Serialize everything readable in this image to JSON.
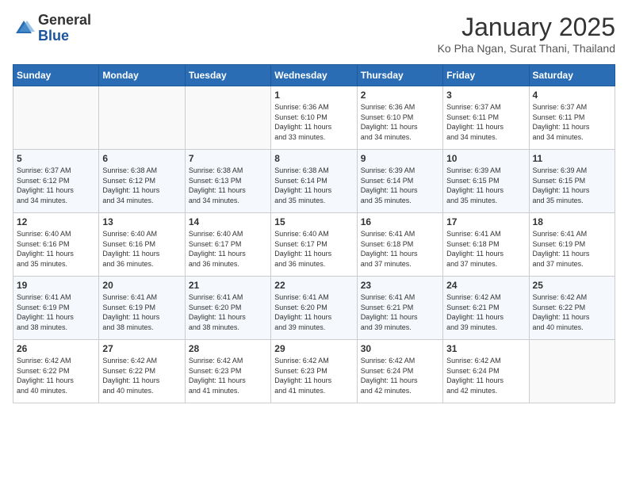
{
  "header": {
    "logo": {
      "general": "General",
      "blue": "Blue"
    },
    "title": "January 2025",
    "subtitle": "Ko Pha Ngan, Surat Thani, Thailand"
  },
  "days_of_week": [
    "Sunday",
    "Monday",
    "Tuesday",
    "Wednesday",
    "Thursday",
    "Friday",
    "Saturday"
  ],
  "weeks": [
    [
      {
        "num": "",
        "info": ""
      },
      {
        "num": "",
        "info": ""
      },
      {
        "num": "",
        "info": ""
      },
      {
        "num": "1",
        "info": "Sunrise: 6:36 AM\nSunset: 6:10 PM\nDaylight: 11 hours\nand 33 minutes."
      },
      {
        "num": "2",
        "info": "Sunrise: 6:36 AM\nSunset: 6:10 PM\nDaylight: 11 hours\nand 34 minutes."
      },
      {
        "num": "3",
        "info": "Sunrise: 6:37 AM\nSunset: 6:11 PM\nDaylight: 11 hours\nand 34 minutes."
      },
      {
        "num": "4",
        "info": "Sunrise: 6:37 AM\nSunset: 6:11 PM\nDaylight: 11 hours\nand 34 minutes."
      }
    ],
    [
      {
        "num": "5",
        "info": "Sunrise: 6:37 AM\nSunset: 6:12 PM\nDaylight: 11 hours\nand 34 minutes."
      },
      {
        "num": "6",
        "info": "Sunrise: 6:38 AM\nSunset: 6:12 PM\nDaylight: 11 hours\nand 34 minutes."
      },
      {
        "num": "7",
        "info": "Sunrise: 6:38 AM\nSunset: 6:13 PM\nDaylight: 11 hours\nand 34 minutes."
      },
      {
        "num": "8",
        "info": "Sunrise: 6:38 AM\nSunset: 6:14 PM\nDaylight: 11 hours\nand 35 minutes."
      },
      {
        "num": "9",
        "info": "Sunrise: 6:39 AM\nSunset: 6:14 PM\nDaylight: 11 hours\nand 35 minutes."
      },
      {
        "num": "10",
        "info": "Sunrise: 6:39 AM\nSunset: 6:15 PM\nDaylight: 11 hours\nand 35 minutes."
      },
      {
        "num": "11",
        "info": "Sunrise: 6:39 AM\nSunset: 6:15 PM\nDaylight: 11 hours\nand 35 minutes."
      }
    ],
    [
      {
        "num": "12",
        "info": "Sunrise: 6:40 AM\nSunset: 6:16 PM\nDaylight: 11 hours\nand 35 minutes."
      },
      {
        "num": "13",
        "info": "Sunrise: 6:40 AM\nSunset: 6:16 PM\nDaylight: 11 hours\nand 36 minutes."
      },
      {
        "num": "14",
        "info": "Sunrise: 6:40 AM\nSunset: 6:17 PM\nDaylight: 11 hours\nand 36 minutes."
      },
      {
        "num": "15",
        "info": "Sunrise: 6:40 AM\nSunset: 6:17 PM\nDaylight: 11 hours\nand 36 minutes."
      },
      {
        "num": "16",
        "info": "Sunrise: 6:41 AM\nSunset: 6:18 PM\nDaylight: 11 hours\nand 37 minutes."
      },
      {
        "num": "17",
        "info": "Sunrise: 6:41 AM\nSunset: 6:18 PM\nDaylight: 11 hours\nand 37 minutes."
      },
      {
        "num": "18",
        "info": "Sunrise: 6:41 AM\nSunset: 6:19 PM\nDaylight: 11 hours\nand 37 minutes."
      }
    ],
    [
      {
        "num": "19",
        "info": "Sunrise: 6:41 AM\nSunset: 6:19 PM\nDaylight: 11 hours\nand 38 minutes."
      },
      {
        "num": "20",
        "info": "Sunrise: 6:41 AM\nSunset: 6:19 PM\nDaylight: 11 hours\nand 38 minutes."
      },
      {
        "num": "21",
        "info": "Sunrise: 6:41 AM\nSunset: 6:20 PM\nDaylight: 11 hours\nand 38 minutes."
      },
      {
        "num": "22",
        "info": "Sunrise: 6:41 AM\nSunset: 6:20 PM\nDaylight: 11 hours\nand 39 minutes."
      },
      {
        "num": "23",
        "info": "Sunrise: 6:41 AM\nSunset: 6:21 PM\nDaylight: 11 hours\nand 39 minutes."
      },
      {
        "num": "24",
        "info": "Sunrise: 6:42 AM\nSunset: 6:21 PM\nDaylight: 11 hours\nand 39 minutes."
      },
      {
        "num": "25",
        "info": "Sunrise: 6:42 AM\nSunset: 6:22 PM\nDaylight: 11 hours\nand 40 minutes."
      }
    ],
    [
      {
        "num": "26",
        "info": "Sunrise: 6:42 AM\nSunset: 6:22 PM\nDaylight: 11 hours\nand 40 minutes."
      },
      {
        "num": "27",
        "info": "Sunrise: 6:42 AM\nSunset: 6:22 PM\nDaylight: 11 hours\nand 40 minutes."
      },
      {
        "num": "28",
        "info": "Sunrise: 6:42 AM\nSunset: 6:23 PM\nDaylight: 11 hours\nand 41 minutes."
      },
      {
        "num": "29",
        "info": "Sunrise: 6:42 AM\nSunset: 6:23 PM\nDaylight: 11 hours\nand 41 minutes."
      },
      {
        "num": "30",
        "info": "Sunrise: 6:42 AM\nSunset: 6:24 PM\nDaylight: 11 hours\nand 42 minutes."
      },
      {
        "num": "31",
        "info": "Sunrise: 6:42 AM\nSunset: 6:24 PM\nDaylight: 11 hours\nand 42 minutes."
      },
      {
        "num": "",
        "info": ""
      }
    ]
  ]
}
